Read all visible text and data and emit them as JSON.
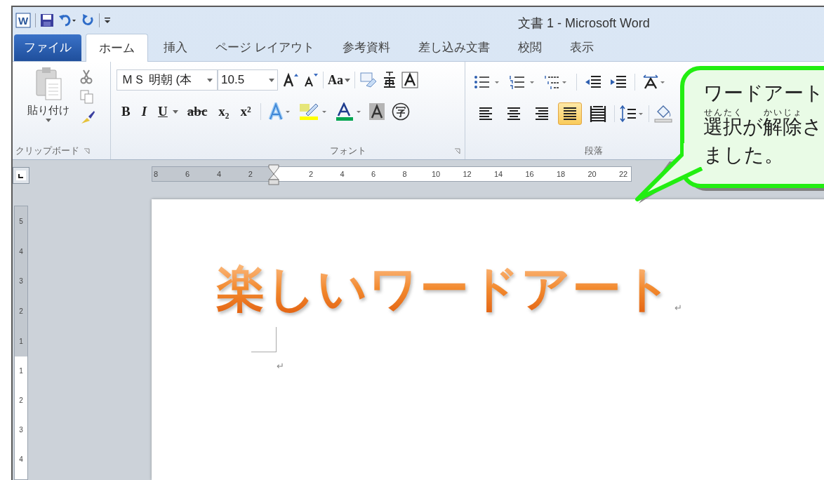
{
  "window": {
    "title": "文書 1 - Microsoft Word",
    "logo_letter": "W"
  },
  "tabs": [
    {
      "label": "ファイル",
      "kind": "file",
      "selected": false
    },
    {
      "label": "ホーム",
      "kind": "tab",
      "selected": true
    },
    {
      "label": "挿入",
      "kind": "tab",
      "selected": false
    },
    {
      "label": "ページ レイアウト",
      "kind": "tab",
      "selected": false
    },
    {
      "label": "参考資料",
      "kind": "tab",
      "selected": false
    },
    {
      "label": "差し込み文書",
      "kind": "tab",
      "selected": false
    },
    {
      "label": "校閲",
      "kind": "tab",
      "selected": false
    },
    {
      "label": "表示",
      "kind": "tab",
      "selected": false
    }
  ],
  "clipboard": {
    "paste_label": "貼り付け",
    "group_label": "クリップボード"
  },
  "font": {
    "font_name": "ＭＳ 明朝 (本",
    "font_size": "10.5",
    "case_label": "Aa",
    "group_label": "フォント",
    "format_buttons": [
      {
        "label": "B",
        "kind": "bold"
      },
      {
        "label": "I",
        "kind": "italic"
      },
      {
        "label": "U",
        "kind": "underline"
      },
      {
        "label": "abc",
        "kind": "strike"
      },
      {
        "label": "x₂",
        "kind": "plain"
      },
      {
        "label": "x²",
        "kind": "plain"
      }
    ]
  },
  "paragraph": {
    "group_label": "段落",
    "alignments": [
      {
        "selected": false
      },
      {
        "selected": false
      },
      {
        "selected": false
      },
      {
        "selected": true
      },
      {
        "selected": false
      }
    ]
  },
  "ruler": {
    "left_numbers": [
      "8",
      "6",
      "4",
      "2"
    ],
    "right_numbers": [
      "2",
      "4",
      "6",
      "8",
      "10",
      "12",
      "14",
      "16",
      "18",
      "20",
      "22"
    ]
  },
  "vertical_ruler": {
    "top_numbers": [
      "5",
      "4",
      "3",
      "2",
      "1"
    ],
    "bottom_numbers": [
      "1",
      "2",
      "3",
      "4"
    ]
  },
  "document": {
    "heading": "楽しいワードアート",
    "heading_mark": "↵",
    "empty_paragraph_mark": "↵"
  },
  "callout": {
    "lines": [
      [
        {
          "text": "ワードアート"
        }
      ],
      [
        {
          "text": "選択",
          "ruby": "せんたく"
        },
        {
          "text": "が"
        },
        {
          "text": "解除",
          "ruby": "かいじょ"
        },
        {
          "text": "さ"
        }
      ],
      [
        {
          "text": "ました。"
        }
      ]
    ]
  }
}
